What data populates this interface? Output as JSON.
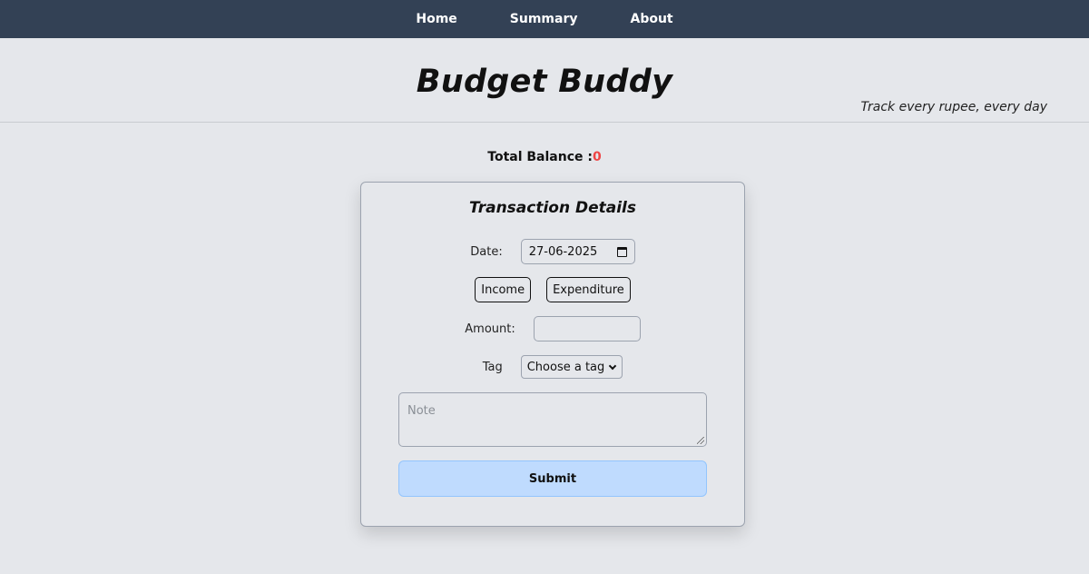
{
  "nav": {
    "items": [
      {
        "label": "Home"
      },
      {
        "label": "Summary"
      },
      {
        "label": "About"
      }
    ]
  },
  "header": {
    "title": "Budget Buddy",
    "tagline": "Track every rupee, every day"
  },
  "balance": {
    "label": "Total Balance :",
    "value": "0",
    "value_color": "#ef4444"
  },
  "form": {
    "title": "Transaction Details",
    "date_label": "Date:",
    "date_value": "27-06-2025",
    "income_label": "Income",
    "expenditure_label": "Expenditure",
    "amount_label": "Amount:",
    "amount_value": "",
    "tag_label": "Tag",
    "tag_selected": "Choose a tag",
    "note_placeholder": "Note",
    "submit_label": "Submit"
  },
  "colors": {
    "navbar": "#334155",
    "background": "#e5e7eb",
    "submit": "#bfdbfe"
  }
}
